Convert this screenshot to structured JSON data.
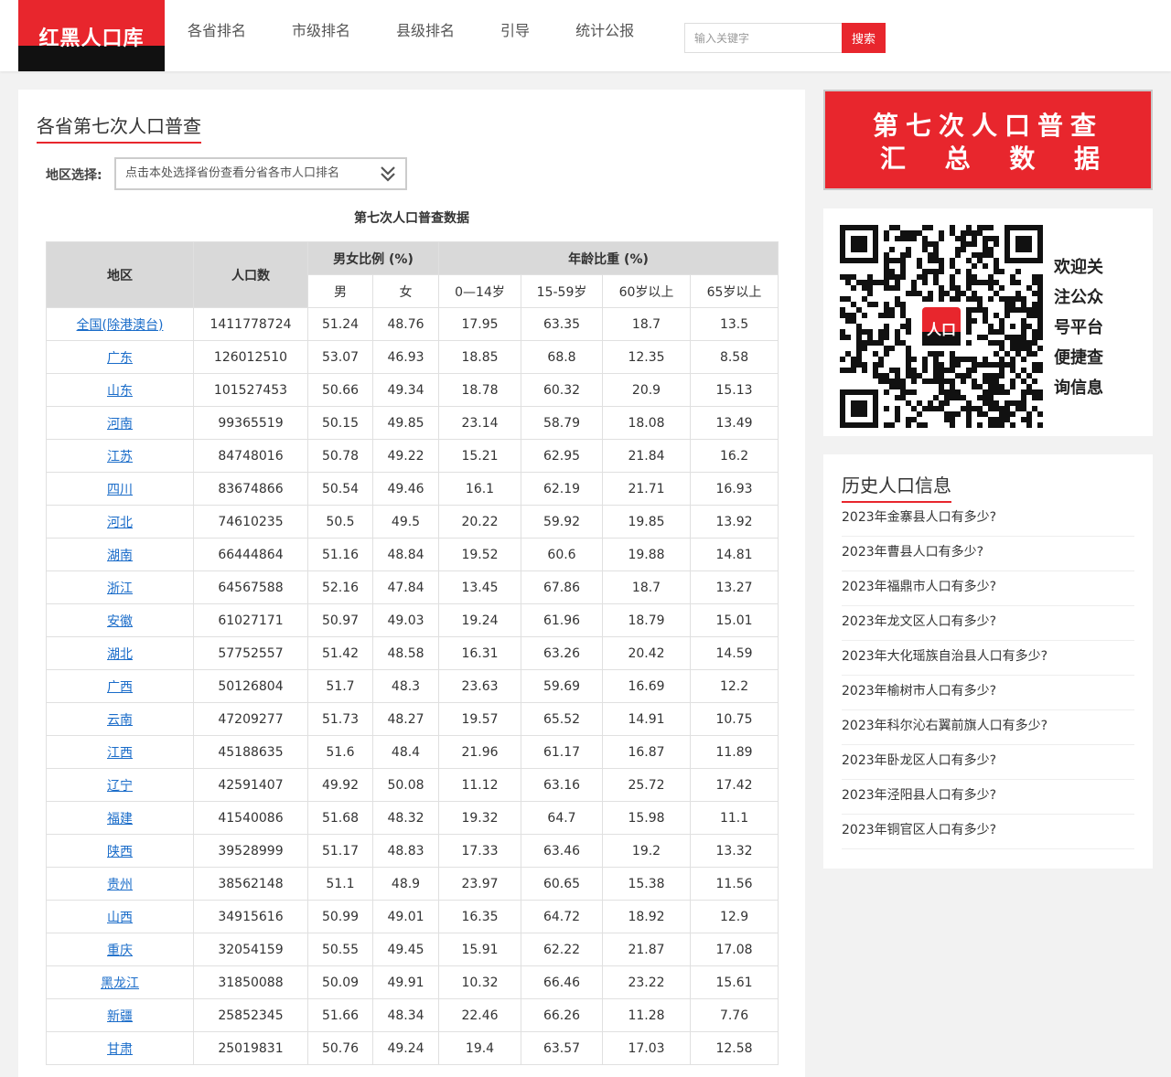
{
  "header": {
    "logo": "红黑人口库",
    "nav": [
      "各省排名",
      "市级排名",
      "县级排名",
      "引导",
      "统计公报"
    ],
    "search_placeholder": "输入关键字",
    "search_button": "搜索"
  },
  "main": {
    "title": "各省第七次人口普查",
    "region_label": "地区选择:",
    "region_select": "点击本处选择省份查看分省各市人口排名",
    "table_title": "第七次人口普查数据",
    "headers": {
      "region": "地区",
      "population": "人口数",
      "sex_ratio": "男女比例 (%)",
      "age_ratio": "年龄比重 (%)",
      "male": "男",
      "female": "女",
      "age1": "0—14岁",
      "age2": "15-59岁",
      "age3": "60岁以上",
      "age4": "65岁以上"
    },
    "rows": [
      [
        "全国(除港澳台)",
        "1411778724",
        "51.24",
        "48.76",
        "17.95",
        "63.35",
        "18.7",
        "13.5"
      ],
      [
        "广东",
        "126012510",
        "53.07",
        "46.93",
        "18.85",
        "68.8",
        "12.35",
        "8.58"
      ],
      [
        "山东",
        "101527453",
        "50.66",
        "49.34",
        "18.78",
        "60.32",
        "20.9",
        "15.13"
      ],
      [
        "河南",
        "99365519",
        "50.15",
        "49.85",
        "23.14",
        "58.79",
        "18.08",
        "13.49"
      ],
      [
        "江苏",
        "84748016",
        "50.78",
        "49.22",
        "15.21",
        "62.95",
        "21.84",
        "16.2"
      ],
      [
        "四川",
        "83674866",
        "50.54",
        "49.46",
        "16.1",
        "62.19",
        "21.71",
        "16.93"
      ],
      [
        "河北",
        "74610235",
        "50.5",
        "49.5",
        "20.22",
        "59.92",
        "19.85",
        "13.92"
      ],
      [
        "湖南",
        "66444864",
        "51.16",
        "48.84",
        "19.52",
        "60.6",
        "19.88",
        "14.81"
      ],
      [
        "浙江",
        "64567588",
        "52.16",
        "47.84",
        "13.45",
        "67.86",
        "18.7",
        "13.27"
      ],
      [
        "安徽",
        "61027171",
        "50.97",
        "49.03",
        "19.24",
        "61.96",
        "18.79",
        "15.01"
      ],
      [
        "湖北",
        "57752557",
        "51.42",
        "48.58",
        "16.31",
        "63.26",
        "20.42",
        "14.59"
      ],
      [
        "广西",
        "50126804",
        "51.7",
        "48.3",
        "23.63",
        "59.69",
        "16.69",
        "12.2"
      ],
      [
        "云南",
        "47209277",
        "51.73",
        "48.27",
        "19.57",
        "65.52",
        "14.91",
        "10.75"
      ],
      [
        "江西",
        "45188635",
        "51.6",
        "48.4",
        "21.96",
        "61.17",
        "16.87",
        "11.89"
      ],
      [
        "辽宁",
        "42591407",
        "49.92",
        "50.08",
        "11.12",
        "63.16",
        "25.72",
        "17.42"
      ],
      [
        "福建",
        "41540086",
        "51.68",
        "48.32",
        "19.32",
        "64.7",
        "15.98",
        "11.1"
      ],
      [
        "陕西",
        "39528999",
        "51.17",
        "48.83",
        "17.33",
        "63.46",
        "19.2",
        "13.32"
      ],
      [
        "贵州",
        "38562148",
        "51.1",
        "48.9",
        "23.97",
        "60.65",
        "15.38",
        "11.56"
      ],
      [
        "山西",
        "34915616",
        "50.99",
        "49.01",
        "16.35",
        "64.72",
        "18.92",
        "12.9"
      ],
      [
        "重庆",
        "32054159",
        "50.55",
        "49.45",
        "15.91",
        "62.22",
        "21.87",
        "17.08"
      ],
      [
        "黑龙江",
        "31850088",
        "50.09",
        "49.91",
        "10.32",
        "66.46",
        "23.22",
        "15.61"
      ],
      [
        "新疆",
        "25852345",
        "51.66",
        "48.34",
        "22.46",
        "66.26",
        "11.28",
        "7.76"
      ],
      [
        "甘肃",
        "25019831",
        "50.76",
        "49.24",
        "19.4",
        "63.57",
        "17.03",
        "12.58"
      ]
    ]
  },
  "sidebar": {
    "banner_line1": "第七次人口普查",
    "banner_line2": [
      "汇",
      "总",
      "数",
      "据"
    ],
    "qr_text": "欢迎关注公众号平台便捷查询信息",
    "qr_logo": "人口",
    "history_title": "历史人口信息",
    "history": [
      "2023年金寨县人口有多少?",
      "2023年曹县人口有多少?",
      "2023年福鼎市人口有多少?",
      "2023年龙文区人口有多少?",
      "2023年大化瑶族自治县人口有多少?",
      "2023年榆树市人口有多少?",
      "2023年科尔沁右翼前旗人口有多少?",
      "2023年卧龙区人口有多少?",
      "2023年泾阳县人口有多少?",
      "2023年铜官区人口有多少?"
    ]
  },
  "colors": {
    "accent": "#e8262d",
    "link": "#1a6cc9",
    "header_bg": "#d9d9d9"
  }
}
